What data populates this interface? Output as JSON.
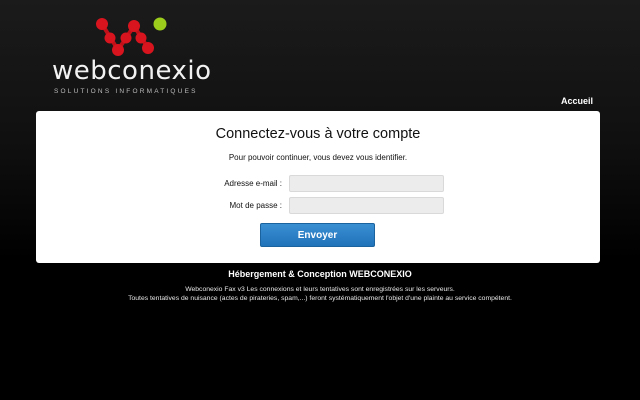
{
  "brand": {
    "name": "webconexio",
    "tagline": "SOLUTIONS INFORMATIQUES"
  },
  "nav": {
    "home_label": "Accueil"
  },
  "login": {
    "title": "Connectez-vous à votre compte",
    "subtitle": "Pour pouvoir continuer, vous devez vous identifier.",
    "email_label": "Adresse e-mail :",
    "email_value": "",
    "password_label": "Mot de passe :",
    "password_value": "",
    "submit_label": "Envoyer"
  },
  "footer": {
    "title": "Hébergement & Conception WEBCONEXIO",
    "line1": "Webconexio Fax v3 Les connexions et leurs tentatives sont enregistrées sur les serveurs.",
    "line2": "Toutes tentatives de nuisance (actes de pirateries, spam,...) feront systématiquement l'objet d'une plainte au service compétent."
  },
  "colors": {
    "logo_red": "#d8141e",
    "logo_green": "#9ccc1c",
    "button_blue": "#2a7fc4"
  }
}
